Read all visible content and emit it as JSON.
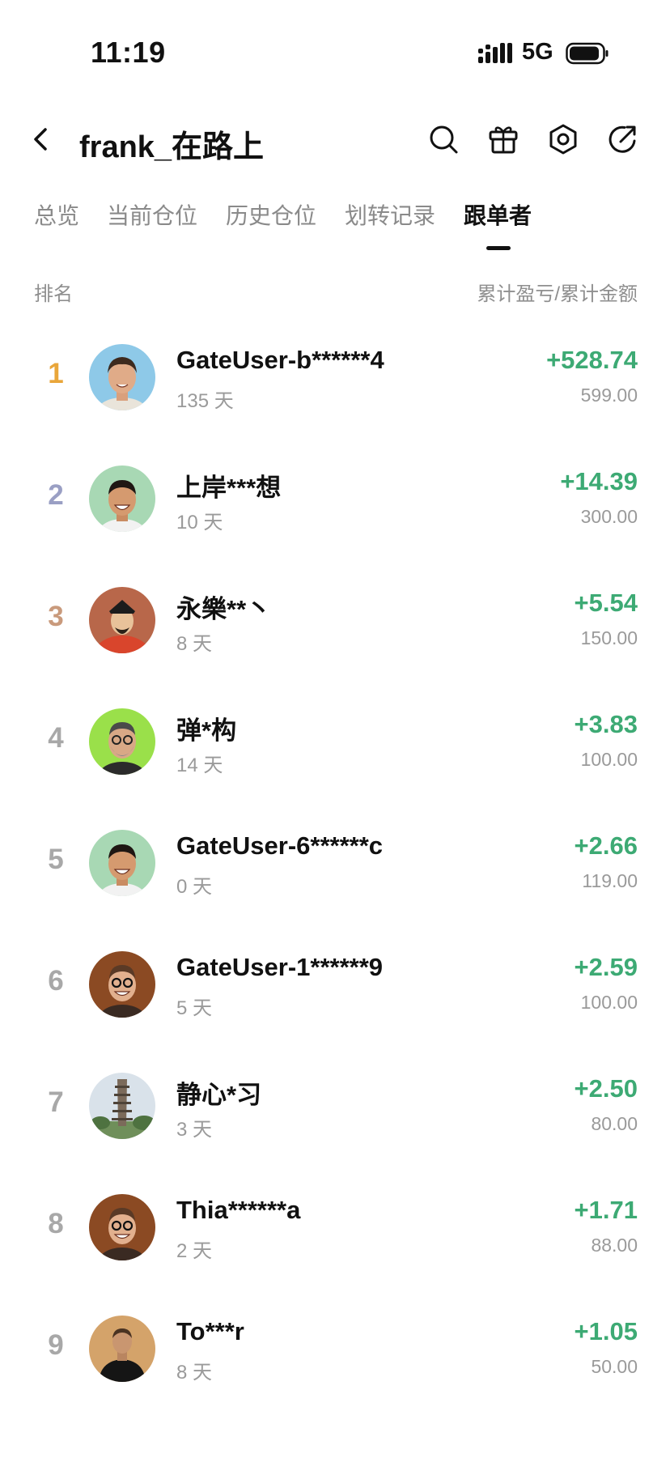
{
  "status_bar": {
    "time": "11:19",
    "network": "5G"
  },
  "header": {
    "title": "frank_在路上"
  },
  "tabs": [
    {
      "label": "总览"
    },
    {
      "label": "当前仓位"
    },
    {
      "label": "历史仓位"
    },
    {
      "label": "划转记录"
    },
    {
      "label": "跟单者"
    }
  ],
  "active_tab": "跟单者",
  "list_header": {
    "left": "排名",
    "right": "累计盈亏/累计金额"
  },
  "colors": {
    "positive": "#3daa74",
    "rank_1": "#e9a63a",
    "rank_2": "#9a9fc4",
    "rank_3": "#c99a7c",
    "rank_other": "#a8a8a8"
  },
  "followers": [
    {
      "rank": "1",
      "name": "GateUser-b******4",
      "days": "135 天",
      "pnl": "+528.74",
      "amount": "599.00",
      "avatar": "smiling-man-blue-bg"
    },
    {
      "rank": "2",
      "name": "上岸***想",
      "days": "10 天",
      "pnl": "+14.39",
      "amount": "300.00",
      "avatar": "smiling-man-green-bg"
    },
    {
      "rank": "3",
      "name": "永樂**丶",
      "days": "8 天",
      "pnl": "+5.54",
      "amount": "150.00",
      "avatar": "emperor-portrait-red-bg"
    },
    {
      "rank": "4",
      "name": "弹*构",
      "days": "14 天",
      "pnl": "+3.83",
      "amount": "100.00",
      "avatar": "bearded-man-lime-bg"
    },
    {
      "rank": "5",
      "name": "GateUser-6******c",
      "days": "0 天",
      "pnl": "+2.66",
      "amount": "119.00",
      "avatar": "smiling-man-green-bg"
    },
    {
      "rank": "6",
      "name": "GateUser-1******9",
      "days": "5 天",
      "pnl": "+2.59",
      "amount": "100.00",
      "avatar": "man-glasses-brown-bg"
    },
    {
      "rank": "7",
      "name": "静心*习",
      "days": "3 天",
      "pnl": "+2.50",
      "amount": "80.00",
      "avatar": "pagoda-photo"
    },
    {
      "rank": "8",
      "name": "Thia******a",
      "days": "2 天",
      "pnl": "+1.71",
      "amount": "88.00",
      "avatar": "man-glasses-brown-bg"
    },
    {
      "rank": "9",
      "name": "To***r",
      "days": "8 天",
      "pnl": "+1.05",
      "amount": "50.00",
      "avatar": "man-black-shirt-tan-bg"
    }
  ]
}
